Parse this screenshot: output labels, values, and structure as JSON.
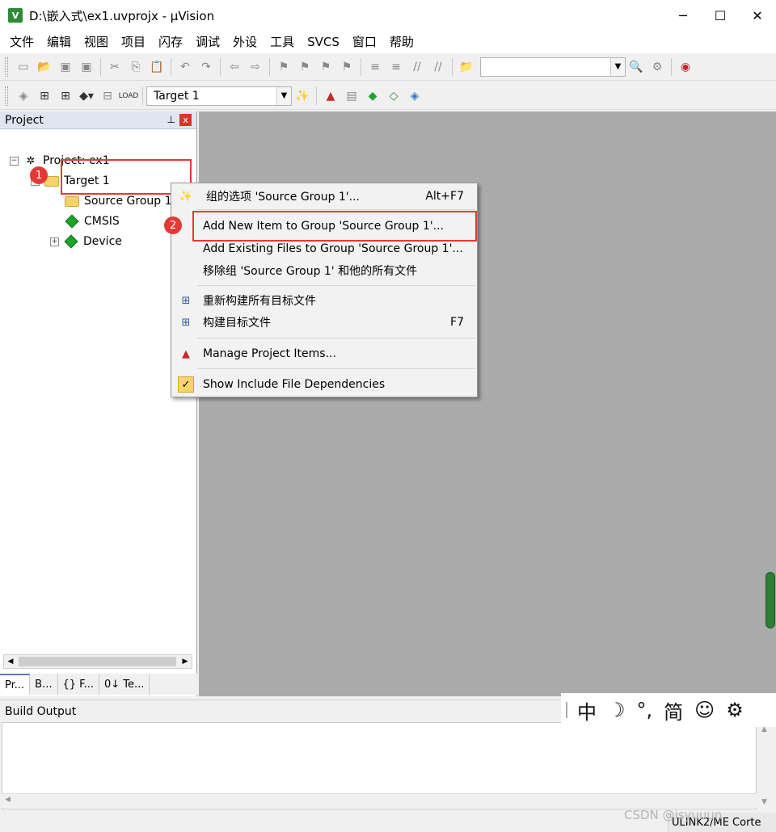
{
  "window": {
    "title": "D:\\嵌入式\\ex1.uvprojx - µVision",
    "app_icon": "uv-logo-icon",
    "minimize": "─",
    "maximize": "☐",
    "close": "✕"
  },
  "menubar": {
    "items": [
      "文件",
      "编辑",
      "视图",
      "项目",
      "闪存",
      "调试",
      "外设",
      "工具",
      "SVCS",
      "窗口",
      "帮助"
    ]
  },
  "toolbar2": {
    "target_combo": "Target 1"
  },
  "project_panel": {
    "title": "Project",
    "pin": "📌",
    "close": "x",
    "tree": {
      "project": "Project: ex1",
      "target": "Target 1",
      "group": "Source Group 1",
      "cmsis": "CMSIS",
      "device": "Device"
    },
    "tabs": [
      "Pr...",
      "B...",
      "{} F...",
      "0↓ Te..."
    ]
  },
  "annotations": {
    "badge1": "1",
    "badge2": "2"
  },
  "context_menu": {
    "items": [
      {
        "label": "组的选项 'Source Group 1'...",
        "shortcut": "Alt+F7",
        "icon": "options-wand-icon"
      },
      {
        "label": "Add New  Item to Group 'Source Group 1'...",
        "shortcut": "",
        "icon": ""
      },
      {
        "label": "Add Existing Files to Group 'Source Group 1'...",
        "shortcut": "",
        "icon": ""
      },
      {
        "label": "移除组 'Source Group 1' 和他的所有文件",
        "shortcut": "",
        "icon": ""
      },
      {
        "label": "重新构建所有目标文件",
        "shortcut": "",
        "icon": "rebuild-icon"
      },
      {
        "label": "构建目标文件",
        "shortcut": "F7",
        "icon": "build-icon"
      },
      {
        "label": "Manage Project Items...",
        "shortcut": "",
        "icon": "manage-items-icon"
      },
      {
        "label": "Show Include File Dependencies",
        "shortcut": "",
        "icon": "checkmark-icon"
      }
    ]
  },
  "build_output": {
    "title": "Build Output"
  },
  "statusbar": {
    "debugger": "ULINK2/ME Corte"
  },
  "ime": {
    "items": [
      "中",
      "☽",
      "°,",
      "简",
      "☺",
      "⚙"
    ]
  },
  "watermark": "CSDN @isyuuun"
}
